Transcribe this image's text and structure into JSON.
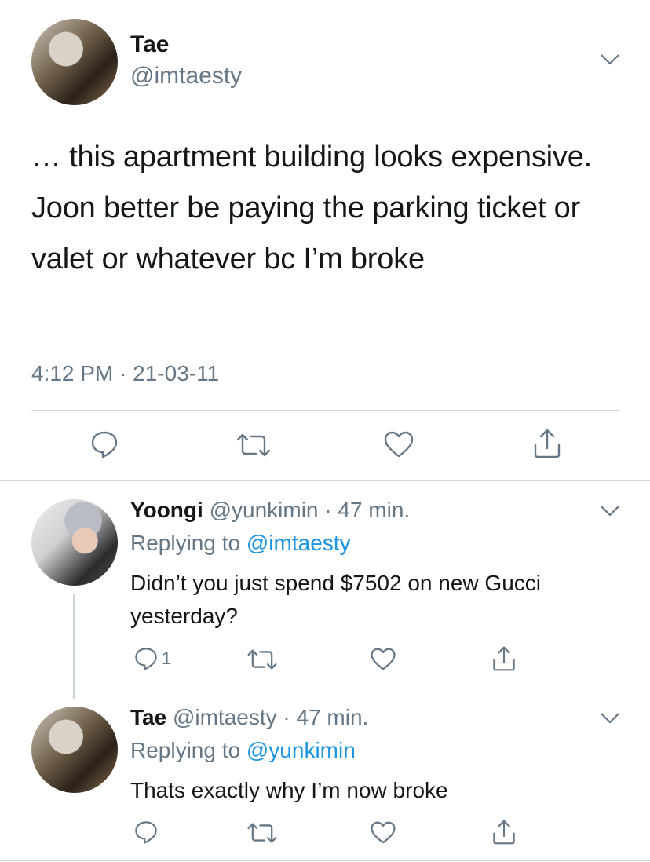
{
  "main_tweet": {
    "name": "Tae",
    "handle": "@imtaesty",
    "text": "… this apartment building looks expensive. Joon better be paying the parking ticket or valet or whatever bc I’m broke",
    "timestamp": "4:12 PM · 21-03-11",
    "icons": [
      "reply-icon",
      "retweet-icon",
      "like-icon",
      "share-icon"
    ]
  },
  "replies": [
    {
      "name": "Yoongi",
      "handle": "@yunkimin",
      "time": "· 47 min.",
      "replying_prefix": "Replying to ",
      "replying_to": "@imtaesty",
      "text": "Didn’t you just spend $7502 on new Gucci yesterday?",
      "reply_count": "1"
    },
    {
      "name": "Tae",
      "handle": "@imtaesty",
      "time": "· 47 min.",
      "replying_prefix": "Replying to ",
      "replying_to": "@yunkimin",
      "text": "Thats exactly why I’m now broke",
      "reply_count": ""
    }
  ],
  "colors": {
    "text": "#14171a",
    "secondary": "#657786",
    "link": "#1b95e0",
    "divider": "#ccd6dd"
  }
}
